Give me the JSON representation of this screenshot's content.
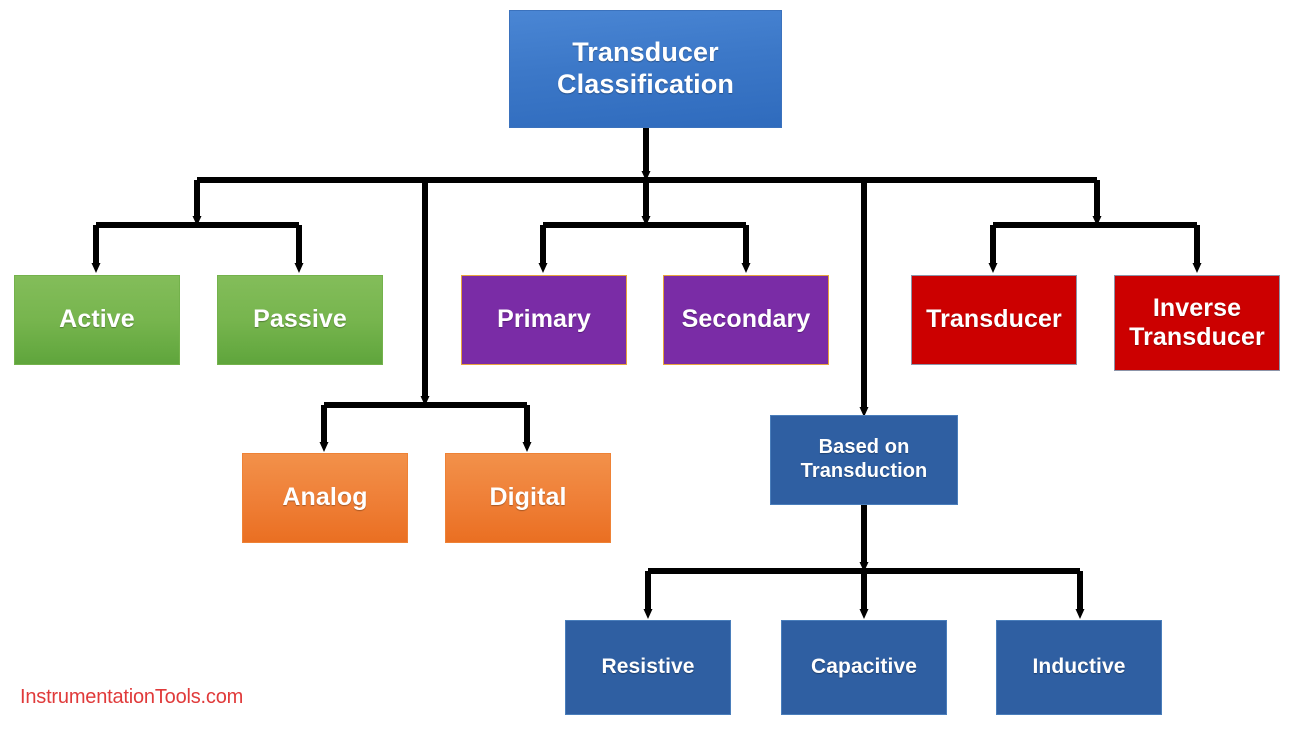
{
  "diagram": {
    "title": "Transducer Classification",
    "watermark": "InstrumentationTools.com",
    "colors": {
      "root": "#3c78c8",
      "green": "#77b54e",
      "purple": "#7a2ca6",
      "red": "#cc0000",
      "orange": "#ef8038",
      "blue": "#2f5fa2",
      "connector": "#000000",
      "watermark": "#e03a3a",
      "purple_border": "#e8a33d",
      "red_border": "#8c94a8",
      "background": "#ffffff"
    },
    "nodes": {
      "root": {
        "label": "Transducer Classification",
        "line1": "Transducer",
        "line2": "Classification"
      },
      "active": {
        "label": "Active"
      },
      "passive": {
        "label": "Passive"
      },
      "primary": {
        "label": "Primary"
      },
      "secondary": {
        "label": "Secondary"
      },
      "transducer": {
        "label": "Transducer"
      },
      "inverse_transducer": {
        "label": "Inverse Transducer",
        "line1": "Inverse",
        "line2": "Transducer"
      },
      "analog": {
        "label": "Analog"
      },
      "digital": {
        "label": "Digital"
      },
      "based_on_transduction": {
        "label": "Based on Transduction",
        "line1": "Based on",
        "line2": "Transduction"
      },
      "resistive": {
        "label": "Resistive"
      },
      "capacitive": {
        "label": "Capacitive"
      },
      "inductive": {
        "label": "Inductive"
      }
    },
    "groups": [
      {
        "name": "active-passive",
        "color": "#77b54e",
        "members": [
          "Active",
          "Passive"
        ]
      },
      {
        "name": "analog-digital",
        "color": "#ef8038",
        "members": [
          "Analog",
          "Digital"
        ]
      },
      {
        "name": "primary-secondary",
        "color": "#7a2ca6",
        "members": [
          "Primary",
          "Secondary"
        ]
      },
      {
        "name": "transducer-inverse",
        "color": "#cc0000",
        "members": [
          "Transducer",
          "Inverse Transducer"
        ]
      },
      {
        "name": "transduction",
        "color": "#2f5fa2",
        "members": [
          "Resistive",
          "Capacitive",
          "Inductive"
        ]
      }
    ],
    "edges": [
      {
        "from": "Transducer Classification",
        "to": "Active"
      },
      {
        "from": "Transducer Classification",
        "to": "Passive"
      },
      {
        "from": "Transducer Classification",
        "to": "Analog"
      },
      {
        "from": "Transducer Classification",
        "to": "Digital"
      },
      {
        "from": "Transducer Classification",
        "to": "Primary"
      },
      {
        "from": "Transducer Classification",
        "to": "Secondary"
      },
      {
        "from": "Transducer Classification",
        "to": "Transducer"
      },
      {
        "from": "Transducer Classification",
        "to": "Inverse Transducer"
      },
      {
        "from": "Transducer Classification",
        "to": "Based on Transduction"
      },
      {
        "from": "Based on Transduction",
        "to": "Resistive"
      },
      {
        "from": "Based on Transduction",
        "to": "Capacitive"
      },
      {
        "from": "Based on Transduction",
        "to": "Inductive"
      }
    ]
  }
}
